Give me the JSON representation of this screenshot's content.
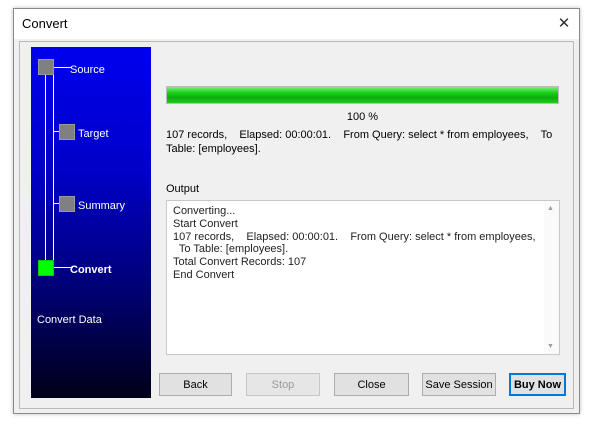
{
  "window": {
    "title": "Convert"
  },
  "sidebar": {
    "steps": [
      {
        "label": "Source",
        "state": "done"
      },
      {
        "label": "Target",
        "state": "done"
      },
      {
        "label": "Summary",
        "state": "done"
      },
      {
        "label": "Convert",
        "state": "active"
      }
    ],
    "footer_label": "Convert Data"
  },
  "progress": {
    "value": 1.0,
    "label": "100 %"
  },
  "status": {
    "line1": "107 records,    Elapsed: 00:00:01.    From Query: select * from employees,    To",
    "line2": "Table: [employees]."
  },
  "output": {
    "label": "Output",
    "lines": [
      "Converting...",
      "Start Convert",
      "107 records,    Elapsed: 00:00:01.    From Query: select * from employees,",
      "  To Table: [employees].",
      "Total Convert Records: 107",
      "End Convert"
    ]
  },
  "buttons": {
    "back": "Back",
    "stop": "Stop",
    "close": "Close",
    "save_session": "Save Session",
    "buy_now": "Buy Now"
  },
  "colors": {
    "active_step": "#00ff00",
    "inactive_step": "#808080",
    "progress": "#19d319",
    "sidebar_top": "#0000ee",
    "sidebar_bottom": "#000018"
  }
}
